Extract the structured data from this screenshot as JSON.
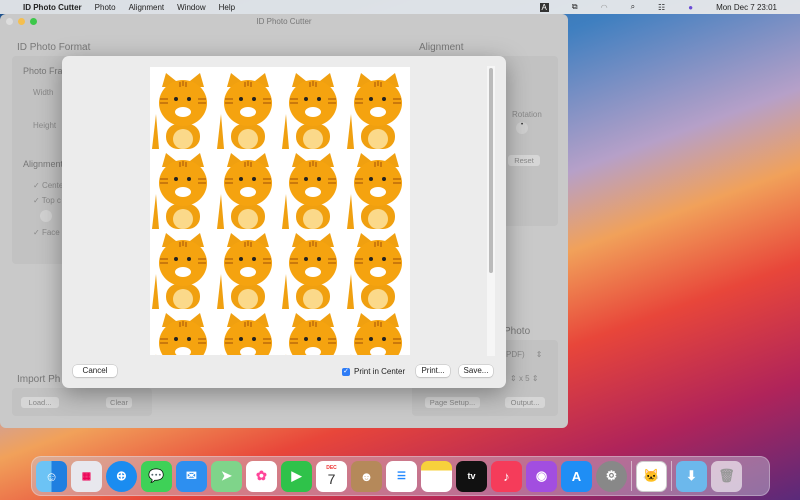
{
  "menubar": {
    "app": "ID Photo Cutter",
    "items": [
      "Photo",
      "Alignment",
      "Window",
      "Help"
    ],
    "datetime": "Mon Dec 7  23:01"
  },
  "window": {
    "title": "ID Photo Cutter",
    "left": {
      "heading": "ID Photo Format",
      "frame": "Photo Fra",
      "width": "Width",
      "height": "Height",
      "alignment": "Alignment",
      "checks": [
        "Cente",
        "Top c",
        "Face"
      ],
      "import": "Import Ph",
      "load": "Load...",
      "clear": "Clear"
    },
    "right": {
      "heading": "Alignment",
      "rotation": "Rotation",
      "reset": "Reset",
      "photo": "Photo",
      "format": "PDF)",
      "count_sep": "x",
      "count": "5",
      "page_setup": "Page Setup...",
      "output": "Output..."
    }
  },
  "dialog": {
    "cancel": "Cancel",
    "print_center": "Print in Center",
    "print_center_checked": true,
    "print": "Print...",
    "save": "Save...",
    "grid_cols": 4,
    "grid_rows": 4
  },
  "dock": {
    "calendar_month": "DEC",
    "calendar_day": "7",
    "apps": [
      "Finder",
      "Launchpad",
      "Safari",
      "Messages",
      "Mail",
      "Maps",
      "Photos",
      "FaceTime",
      "Calendar",
      "Contacts",
      "Reminders",
      "Notes",
      "TV",
      "Music",
      "Podcasts",
      "App Store",
      "System Preferences",
      "ID Photo Cutter",
      "Downloads",
      "Trash"
    ]
  }
}
